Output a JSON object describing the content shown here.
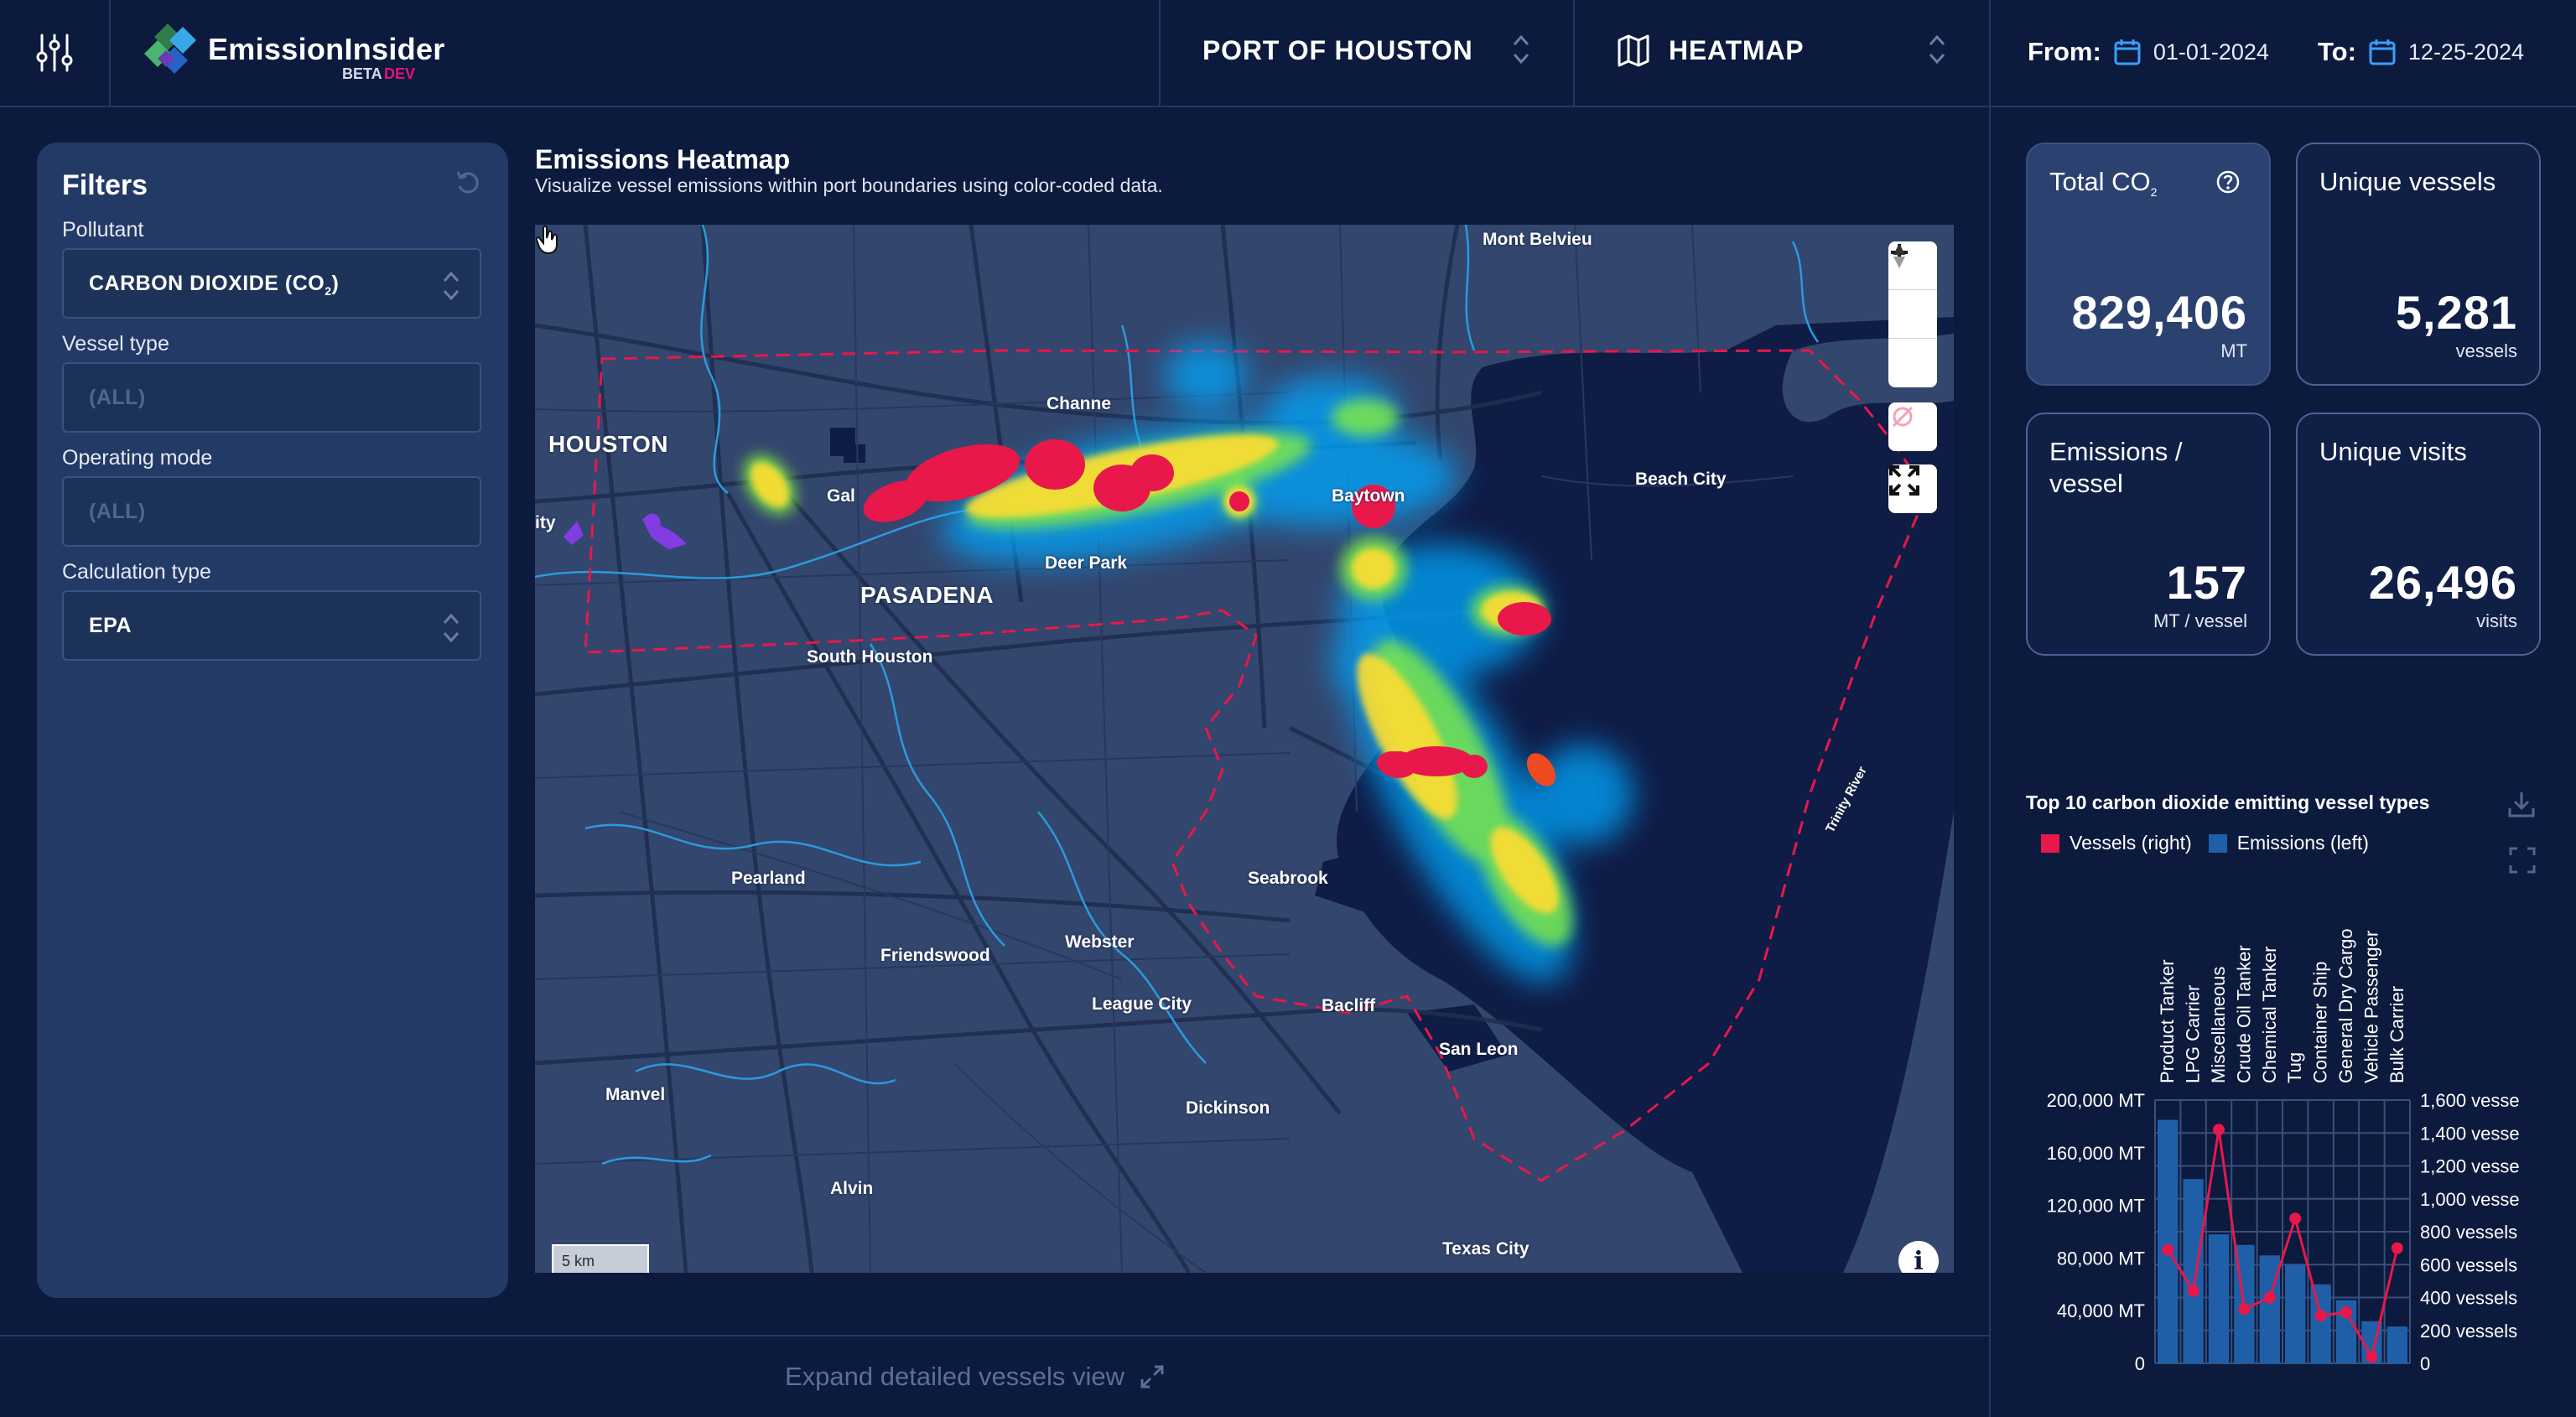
{
  "app": {
    "brand": "EmissionInsider",
    "beta": "BETA",
    "dev": "DEV",
    "settings_icon": "sliders-icon"
  },
  "header": {
    "port": "PORT OF HOUSTON",
    "view": "HEATMAP",
    "from_label": "From:",
    "from_date": "01-01-2024",
    "to_label": "To:",
    "to_date": "12-25-2024"
  },
  "filters": {
    "title": "Filters",
    "pollutant_label": "Pollutant",
    "pollutant_value": "CARBON DIOXIDE (CO",
    "pollutant_sub": "2",
    "pollutant_close": ")",
    "vessel_type_label": "Vessel type",
    "vessel_type_value": "(ALL)",
    "operating_mode_label": "Operating mode",
    "operating_mode_value": "(ALL)",
    "calc_type_label": "Calculation type",
    "calc_type_value": "EPA"
  },
  "heatmap": {
    "title": "Emissions Heatmap",
    "subtitle": "Visualize vessel emissions within port boundaries using color-coded data.",
    "scale": "5 km",
    "places": {
      "mont_belvieu": "Mont Belvieu",
      "houston": "HOUSTON",
      "channelview": "Channe",
      "galena": "Gal",
      "baytown": "Baytown",
      "beach_city": "Beach City",
      "ity": "ity",
      "pasadena": "PASADENA",
      "deer_park": "Deer Park",
      "south_houston": "South Houston",
      "pearland": "Pearland",
      "seabrook": "Seabrook",
      "friendswood": "Friendswood",
      "webster": "Webster",
      "league_city": "League City",
      "bacliff": "Bacliff",
      "san_leon": "San Leon",
      "manvel": "Manvel",
      "dickinson": "Dickinson",
      "alvin": "Alvin",
      "texas_city": "Texas City",
      "trinity_river": "Trinity River"
    }
  },
  "footer": {
    "expand": "Expand detailed vessels view"
  },
  "kpis": {
    "total_co2_title": "Total CO",
    "total_co2_sub": "2",
    "total_co2_value": "829,406",
    "total_co2_unit": "MT",
    "unique_vessels_title": "Unique vessels",
    "unique_vessels_value": "5,281",
    "unique_vessels_unit": "vessels",
    "emissions_per_vessel_title_1": "Emissions /",
    "emissions_per_vessel_title_2": "vessel",
    "emissions_per_vessel_value": "157",
    "emissions_per_vessel_unit": "MT / vessel",
    "unique_visits_title": "Unique visits",
    "unique_visits_value": "26,496",
    "unique_visits_unit": "visits"
  },
  "chart": {
    "title": "Top 10 carbon dioxide emitting vessel types",
    "legend_vessels": "Vessels (right)",
    "legend_emissions": "Emissions (left)",
    "vessels_color": "#e8184a",
    "emissions_color": "#1f5fa8"
  },
  "chart_data": {
    "type": "bar",
    "categories": [
      "Product Tanker",
      "LPG Carrier",
      "Miscellaneous",
      "Crude Oil Tanker",
      "Chemical Tanker",
      "Tug",
      "Container Ship",
      "General Dry Cargo",
      "Vehicle Passenger",
      "Bulk Carrier"
    ],
    "series": [
      {
        "name": "Emissions (left)",
        "type": "bar",
        "axis": "left",
        "values": [
          185000,
          140000,
          98000,
          90000,
          82000,
          75000,
          60000,
          48000,
          32000,
          28000
        ]
      },
      {
        "name": "Vessels (right)",
        "type": "line",
        "axis": "right",
        "values": [
          690,
          440,
          1420,
          330,
          400,
          880,
          290,
          310,
          40,
          700
        ]
      }
    ],
    "left_ticks": [
      "0",
      "40,000 MT",
      "80,000 MT",
      "120,000 MT",
      "160,000 MT",
      "200,000 MT"
    ],
    "right_ticks": [
      "0",
      "200 vessels",
      "400 vessels",
      "600 vessels",
      "800 vessels",
      "1,000 vesse",
      "1,200 vesse",
      "1,400 vesse",
      "1,600 vesse"
    ],
    "ylim_left": [
      0,
      200000
    ],
    "ylim_right": [
      0,
      1600
    ],
    "grid": true
  }
}
